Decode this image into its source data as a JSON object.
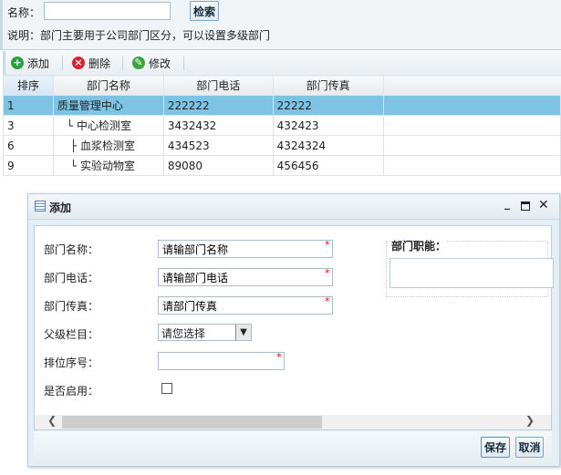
{
  "search": {
    "label": "名称：",
    "value": "",
    "button": "检索",
    "note": "说明：部门主要用于公司部门区分，可以设置多级部门"
  },
  "toolbar": {
    "add": "添加",
    "delete": "删除",
    "edit": "修改"
  },
  "table": {
    "headers": [
      "排序",
      "部门名称",
      "部门电话",
      "部门传真"
    ],
    "rows": [
      [
        "1",
        "质量管理中心",
        "222222",
        "22222"
      ],
      [
        "3",
        "└ 中心检测室",
        "3432432",
        "432423"
      ],
      [
        "6",
        "├ 血浆检测室",
        "434523",
        "4324324"
      ],
      [
        "9",
        "└ 实验动物室",
        "89080",
        "456456"
      ]
    ]
  },
  "dialog": {
    "title": "添加",
    "fields": {
      "name_label": "部门名称：",
      "name_value": "请输部门名称",
      "phone_label": "部门电话：",
      "phone_value": "请输部门电话",
      "fax_label": "部门传真：",
      "fax_value": "请部门传真",
      "parent_label": "父级栏目：",
      "parent_value": "请您选择",
      "order_label": "排位序号：",
      "order_value": "",
      "enabled_label": "是否启用："
    },
    "function_label": "部门职能：",
    "save": "保存",
    "cancel": "取消"
  },
  "colors": {
    "selected_row": "#7cc3e4",
    "required": "#ee0000"
  }
}
